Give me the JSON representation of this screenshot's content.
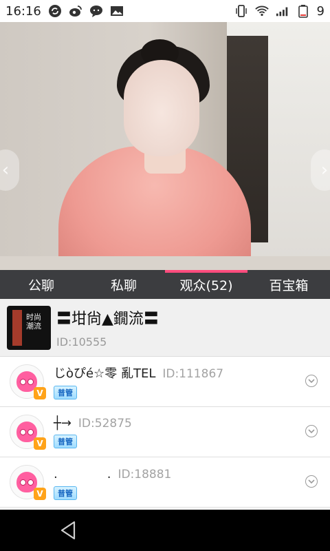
{
  "status_bar": {
    "time": "16:16",
    "battery_level": "9",
    "icons": [
      "sync-icon",
      "weibo-icon",
      "chat-icon",
      "image-icon",
      "vibrate-icon",
      "wifi-icon",
      "signal-icon",
      "battery-icon"
    ]
  },
  "tabs": [
    {
      "label": "公聊",
      "active": false
    },
    {
      "label": "私聊",
      "active": false
    },
    {
      "label": "观众(52)",
      "active": true
    },
    {
      "label": "百宝箱",
      "active": false
    }
  ],
  "anchor": {
    "name": "〓坩尙▲鐗流〓",
    "id": "ID:10555",
    "avatar_text": "时尚潮流"
  },
  "viewers": [
    {
      "name": "じòぴé☆零 亂TEL",
      "id": "ID:111867",
      "tag": "普管",
      "badge": "V"
    },
    {
      "name": "┼→",
      "id": "ID:52875",
      "tag": "普管",
      "badge": "V"
    },
    {
      "name": ".　　　　.",
      "id": "ID:18881",
      "tag": "普管",
      "badge": "V"
    }
  ],
  "colors": {
    "tab_bar_bg": "#3c3d40",
    "tab_active_indicator": "#ff4c7d",
    "vip_badge": "#ffa31a",
    "tag_bg": "#9fdcff"
  }
}
